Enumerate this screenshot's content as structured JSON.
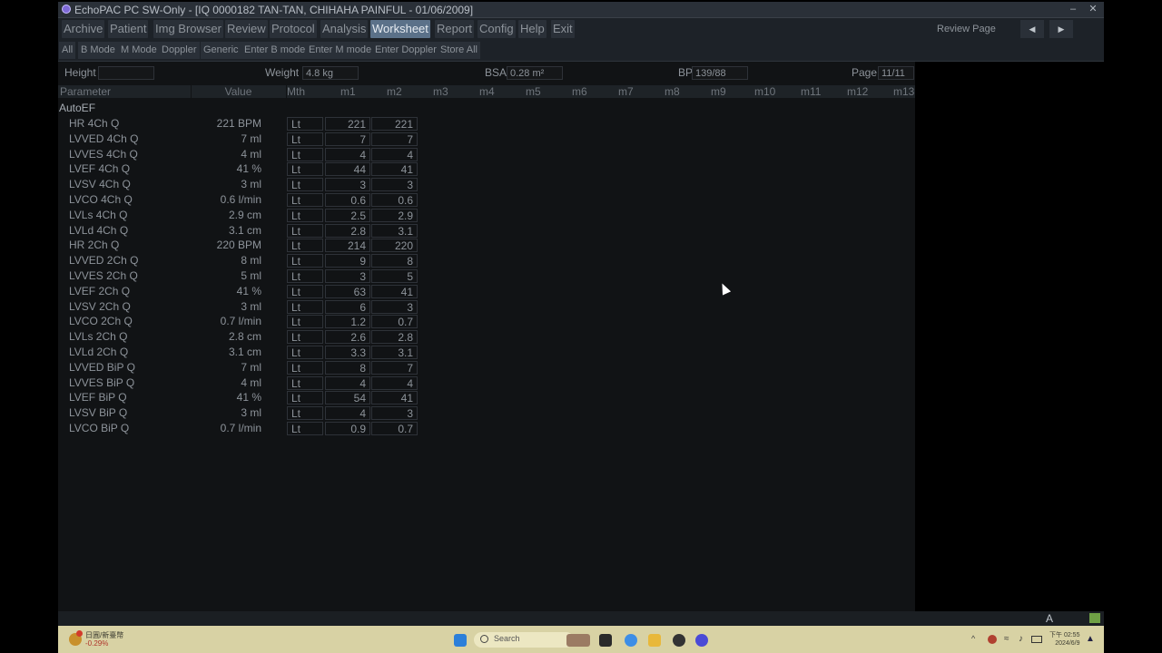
{
  "window": {
    "title": "EchoPAC PC SW-Only - [IQ 0000182 TAN-TAN, CHIHAHA PAINFUL  - 01/06/2009]",
    "min_icon": "minimize-icon",
    "close_icon": "close-icon"
  },
  "menu": [
    {
      "label": "Archive"
    },
    {
      "label": "Patient"
    },
    {
      "label": "Img Browser"
    },
    {
      "label": "Review"
    },
    {
      "label": "Protocol"
    },
    {
      "label": "Analysis"
    },
    {
      "label": "Worksheet",
      "active": true
    },
    {
      "label": "Report"
    },
    {
      "label": "Config"
    },
    {
      "label": "Help"
    },
    {
      "label": "Exit"
    }
  ],
  "review_page": "Review Page",
  "submenu": [
    {
      "label": "All"
    },
    {
      "label": "B Mode"
    },
    {
      "label": "M Mode"
    },
    {
      "label": "Doppler"
    },
    {
      "label": "Generic"
    },
    {
      "label": "Enter B mode"
    },
    {
      "label": "Enter M mode"
    },
    {
      "label": "Enter Doppler"
    },
    {
      "label": "Store All"
    }
  ],
  "patient_info": {
    "height_label": "Height",
    "height_value": "",
    "weight_label": "Weight",
    "weight_value": "4.8 kg",
    "bsa_label": "BSA",
    "bsa_value": "0.28 m²",
    "bp_label": "BP",
    "bp_value": "139/88",
    "page_label": "Page",
    "page_value": "11/11"
  },
  "table": {
    "headers": {
      "parameter": "Parameter",
      "value": "Value",
      "mth": "Mth",
      "m": [
        "m1",
        "m2",
        "m3",
        "m4",
        "m5",
        "m6",
        "m7",
        "m8",
        "m9",
        "m10",
        "m11",
        "m12",
        "m13"
      ]
    },
    "section": "AutoEF",
    "rows": [
      {
        "name": "HR 4Ch Q",
        "value": "221 BPM",
        "mth": "Lt",
        "m1": "221",
        "m2": "221"
      },
      {
        "name": "LVVED 4Ch Q",
        "value": "7 ml",
        "mth": "Lt",
        "m1": "7",
        "m2": "7"
      },
      {
        "name": "LVVES 4Ch Q",
        "value": "4 ml",
        "mth": "Lt",
        "m1": "4",
        "m2": "4"
      },
      {
        "name": "LVEF 4Ch Q",
        "value": "41 %",
        "mth": "Lt",
        "m1": "44",
        "m2": "41"
      },
      {
        "name": "LVSV 4Ch Q",
        "value": "3 ml",
        "mth": "Lt",
        "m1": "3",
        "m2": "3"
      },
      {
        "name": "LVCO 4Ch Q",
        "value": "0.6 l/min",
        "mth": "Lt",
        "m1": "0.6",
        "m2": "0.6"
      },
      {
        "name": "LVLs 4Ch Q",
        "value": "2.9 cm",
        "mth": "Lt",
        "m1": "2.5",
        "m2": "2.9"
      },
      {
        "name": "LVLd 4Ch Q",
        "value": "3.1 cm",
        "mth": "Lt",
        "m1": "2.8",
        "m2": "3.1"
      },
      {
        "name": "HR 2Ch Q",
        "value": "220 BPM",
        "mth": "Lt",
        "m1": "214",
        "m2": "220"
      },
      {
        "name": "LVVED 2Ch Q",
        "value": "8 ml",
        "mth": "Lt",
        "m1": "9",
        "m2": "8"
      },
      {
        "name": "LVVES 2Ch Q",
        "value": "5 ml",
        "mth": "Lt",
        "m1": "3",
        "m2": "5"
      },
      {
        "name": "LVEF 2Ch Q",
        "value": "41 %",
        "mth": "Lt",
        "m1": "63",
        "m2": "41"
      },
      {
        "name": "LVSV 2Ch Q",
        "value": "3 ml",
        "mth": "Lt",
        "m1": "6",
        "m2": "3"
      },
      {
        "name": "LVCO 2Ch Q",
        "value": "0.7 l/min",
        "mth": "Lt",
        "m1": "1.2",
        "m2": "0.7"
      },
      {
        "name": "LVLs 2Ch Q",
        "value": "2.8 cm",
        "mth": "Lt",
        "m1": "2.6",
        "m2": "2.8"
      },
      {
        "name": "LVLd 2Ch Q",
        "value": "3.1 cm",
        "mth": "Lt",
        "m1": "3.3",
        "m2": "3.1"
      },
      {
        "name": "LVVED BiP Q",
        "value": "7 ml",
        "mth": "Lt",
        "m1": "8",
        "m2": "7"
      },
      {
        "name": "LVVES BiP Q",
        "value": "4 ml",
        "mth": "Lt",
        "m1": "4",
        "m2": "4"
      },
      {
        "name": "LVEF BiP Q",
        "value": "41 %",
        "mth": "Lt",
        "m1": "54",
        "m2": "41"
      },
      {
        "name": "LVSV BiP Q",
        "value": "3 ml",
        "mth": "Lt",
        "m1": "4",
        "m2": "3"
      },
      {
        "name": "LVCO BiP Q",
        "value": "0.7 l/min",
        "mth": "Lt",
        "m1": "0.9",
        "m2": "0.7"
      }
    ]
  },
  "status": {
    "font_indicator": "A"
  },
  "taskbar": {
    "weather_line1": "日圓/新臺幣",
    "weather_line2": "-0.29%",
    "search_placeholder": "Search",
    "clock_time": "下午 02:55",
    "clock_date": "2024/6/9"
  },
  "colors": {
    "accent": "#5b7189",
    "taskbar": "#d8d2a4"
  }
}
